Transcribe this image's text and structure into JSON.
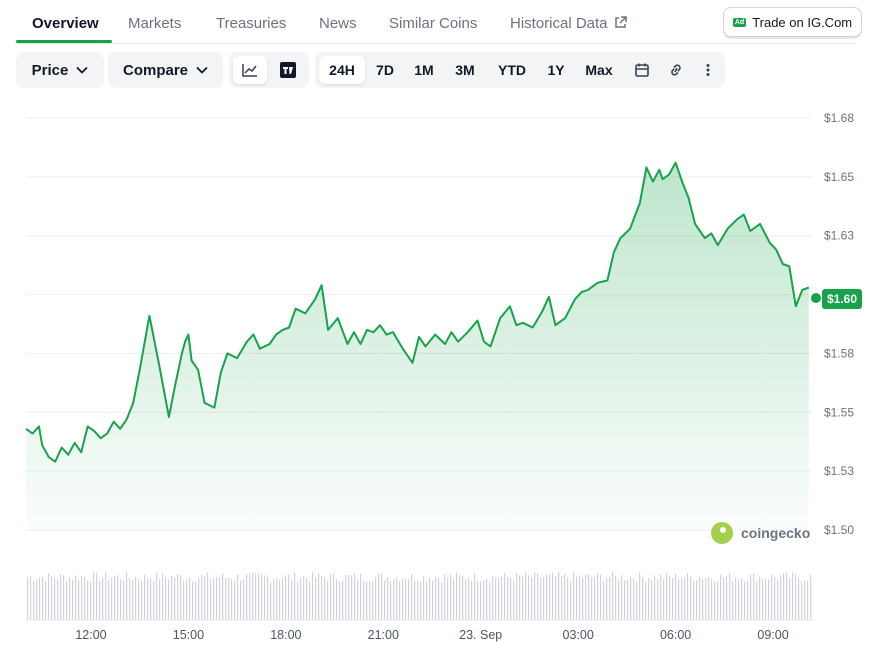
{
  "tabs": {
    "items": [
      {
        "label": "Overview"
      },
      {
        "label": "Markets"
      },
      {
        "label": "Treasuries"
      },
      {
        "label": "News"
      },
      {
        "label": "Similar Coins"
      },
      {
        "label": "Historical Data"
      }
    ],
    "active_index": 0
  },
  "ad": {
    "badge": "Ad",
    "label": "Trade on IG.Com"
  },
  "toolbar": {
    "price_label": "Price",
    "compare_label": "Compare",
    "ranges": [
      "24H",
      "7D",
      "1M",
      "3M",
      "YTD",
      "1Y",
      "Max"
    ],
    "selected_range": "24H",
    "chart_mode": "line"
  },
  "current_price": "$1.60",
  "watermark": "coingecko",
  "colors": {
    "line": "#16a34a",
    "accent": "#16a34a",
    "volume": "#d1d5db"
  },
  "chart_data": {
    "type": "area",
    "title": "",
    "xlabel": "",
    "ylabel": "",
    "y_ticks": [
      "$1.50",
      "$1.53",
      "$1.55",
      "$1.58",
      "$1.60",
      "$1.63",
      "$1.65",
      "$1.68"
    ],
    "ylim": [
      1.5,
      1.675
    ],
    "x_ticks": [
      "12:00",
      "15:00",
      "18:00",
      "21:00",
      "23. Sep",
      "03:00",
      "06:00",
      "09:00"
    ],
    "x_tick_hours": [
      12,
      15,
      18,
      21,
      24,
      27,
      30,
      33
    ],
    "xlim_hours": [
      10.0,
      34.2
    ],
    "series": [
      {
        "x_hours": [
          10.0,
          10.2,
          10.4,
          10.5,
          10.7,
          10.9,
          11.1,
          11.3,
          11.5,
          11.7,
          11.9,
          12.1,
          12.3,
          12.5,
          12.7,
          12.9,
          13.1,
          13.3,
          13.5,
          13.8,
          14.1,
          14.4,
          14.6,
          14.8,
          14.9,
          15.0,
          15.1,
          15.3,
          15.5,
          15.8,
          16.0,
          16.2,
          16.5,
          16.8,
          17.0,
          17.2,
          17.5,
          17.7,
          17.9,
          18.1,
          18.3,
          18.6,
          18.9,
          19.1,
          19.3,
          19.6,
          19.9,
          20.1,
          20.3,
          20.5,
          20.7,
          20.9,
          21.1,
          21.3,
          21.6,
          21.9,
          22.1,
          22.3,
          22.6,
          22.9,
          23.1,
          23.3,
          23.6,
          23.9,
          24.1,
          24.3,
          24.6,
          24.9,
          25.1,
          25.3,
          25.6,
          25.9,
          26.1,
          26.3,
          26.6,
          26.9,
          27.1,
          27.3,
          27.6,
          27.9,
          28.1,
          28.3,
          28.6,
          28.9,
          29.1,
          29.3,
          29.5,
          29.6,
          29.8,
          30.0,
          30.2,
          30.4,
          30.6,
          30.9,
          31.1,
          31.3,
          31.6,
          31.9,
          32.1,
          32.3,
          32.6,
          32.9,
          33.1,
          33.3,
          33.5,
          33.7,
          33.9,
          34.1
        ],
        "values": [
          1.543,
          1.541,
          1.544,
          1.536,
          1.531,
          1.529,
          1.535,
          1.532,
          1.537,
          1.533,
          1.544,
          1.542,
          1.539,
          1.541,
          1.546,
          1.543,
          1.547,
          1.554,
          1.568,
          1.591,
          1.57,
          1.548,
          1.562,
          1.575,
          1.58,
          1.583,
          1.572,
          1.568,
          1.554,
          1.552,
          1.567,
          1.575,
          1.573,
          1.58,
          1.583,
          1.577,
          1.579,
          1.583,
          1.585,
          1.586,
          1.594,
          1.592,
          1.598,
          1.604,
          1.585,
          1.59,
          1.579,
          1.584,
          1.579,
          1.585,
          1.584,
          1.587,
          1.583,
          1.584,
          1.577,
          1.571,
          1.582,
          1.578,
          1.583,
          1.579,
          1.584,
          1.58,
          1.584,
          1.589,
          1.58,
          1.578,
          1.59,
          1.595,
          1.587,
          1.588,
          1.586,
          1.593,
          1.599,
          1.587,
          1.59,
          1.598,
          1.601,
          1.602,
          1.605,
          1.606,
          1.618,
          1.624,
          1.628,
          1.639,
          1.654,
          1.648,
          1.653,
          1.649,
          1.651,
          1.656,
          1.648,
          1.641,
          1.63,
          1.624,
          1.626,
          1.621,
          1.628,
          1.632,
          1.634,
          1.627,
          1.63,
          1.622,
          1.619,
          1.613,
          1.612,
          1.595,
          1.602,
          1.603
        ]
      }
    ],
    "volume": {
      "shown": true
    },
    "grid": true,
    "legend": "none"
  }
}
